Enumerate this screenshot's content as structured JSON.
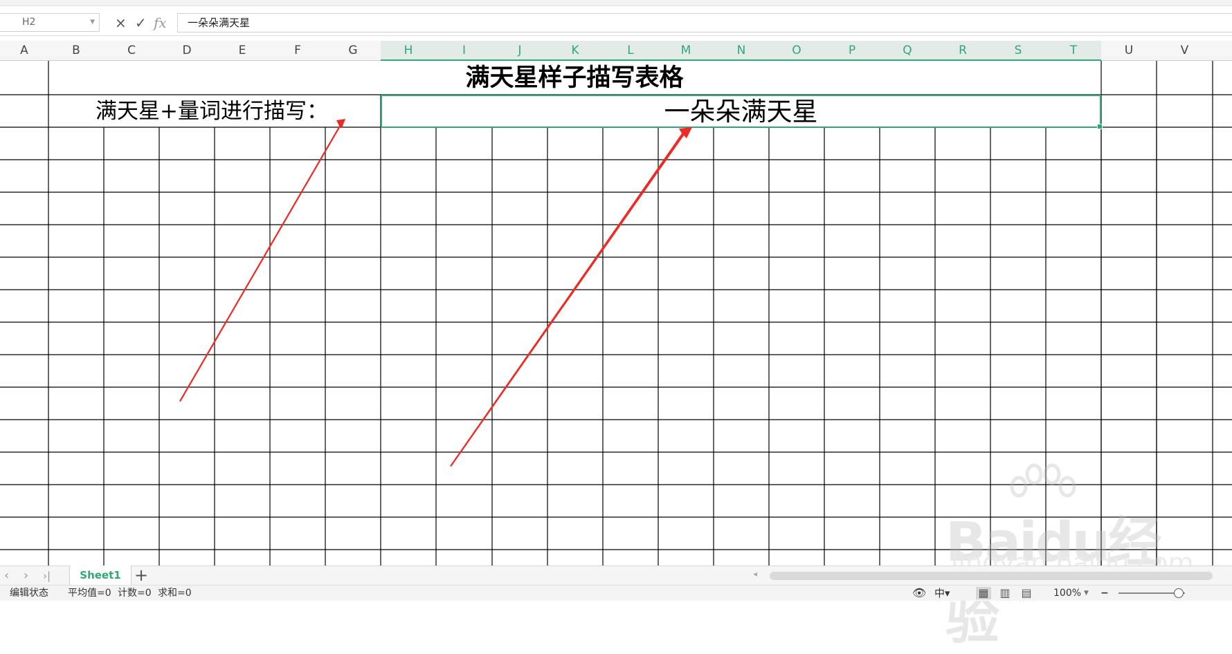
{
  "formula_bar": {
    "cell_reference": "H2",
    "cancel_icon": "×",
    "confirm_icon": "✓",
    "function_label": "fx",
    "content": "一朵朵满天星"
  },
  "columns": [
    "A",
    "B",
    "C",
    "D",
    "E",
    "F",
    "G",
    "H",
    "I",
    "J",
    "K",
    "L",
    "M",
    "N",
    "O",
    "P",
    "Q",
    "R",
    "S",
    "T",
    "U",
    "V"
  ],
  "selected_columns": [
    "H",
    "I",
    "J",
    "K",
    "L",
    "M",
    "N",
    "O",
    "P",
    "Q",
    "R",
    "S",
    "T"
  ],
  "cells": {
    "title": "满天星样子描写表格",
    "label": "满天星+量词进行描写：",
    "value": "一朵朵满天星"
  },
  "sheet_tabs": {
    "nav_first": "‹",
    "nav_next": "›",
    "nav_last": "›|",
    "active": "Sheet1",
    "add_label": "+"
  },
  "status": {
    "mode": "编辑状态",
    "average": "平均值=0",
    "count": "计数=0",
    "sum": "求和=0",
    "zoom": "100%",
    "zoom_minus": "−"
  },
  "watermark": {
    "brand": "Baidu经验",
    "url": "jingyan.baidu.com"
  },
  "colors": {
    "accent": "#2ea876",
    "arrow": "#ee2a24",
    "gridline": "#000000"
  }
}
